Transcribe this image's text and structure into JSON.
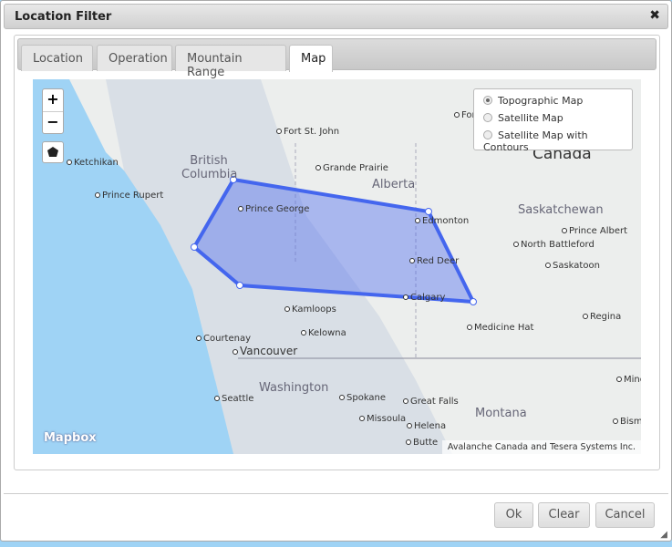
{
  "dialog": {
    "title": "Location Filter",
    "close_icon": "close-icon"
  },
  "tabs": [
    {
      "label": "Location"
    },
    {
      "label": "Operation"
    },
    {
      "label": "Mountain Range"
    },
    {
      "label": "Map",
      "active": true
    }
  ],
  "map": {
    "zoom_in": "+",
    "zoom_out": "−",
    "layers": [
      {
        "label": "Topographic Map",
        "selected": true
      },
      {
        "label": "Satellite Map",
        "selected": false
      },
      {
        "label": "Satellite Map with Contours",
        "selected": false
      }
    ],
    "logo": "Mapbox",
    "attribution": "Avalanche Canada and Tesera Systems Inc.",
    "country": "Canada",
    "regions": [
      "British Columbia",
      "Alberta",
      "Saskatchewan",
      "Washington",
      "Montana"
    ],
    "cities": [
      "Fort St. John",
      "Ketchikan",
      "Grande Prairie",
      "Prince Rupert",
      "Prince George",
      "Edmonton",
      "North Battleford",
      "Prince Albert",
      "Red Deer",
      "Saskatoon",
      "Calgary",
      "Kamloops",
      "Kelowna",
      "Courtenay",
      "Vancouver",
      "Medicine Hat",
      "Regina",
      "Seattle",
      "Spokane",
      "Great Falls",
      "Missoula",
      "Helena",
      "Butte",
      "For",
      "Mino",
      "Bisma"
    ],
    "polygon_color": "#4466ee"
  },
  "footer": {
    "ok": "Ok",
    "clear": "Clear",
    "cancel": "Cancel"
  }
}
